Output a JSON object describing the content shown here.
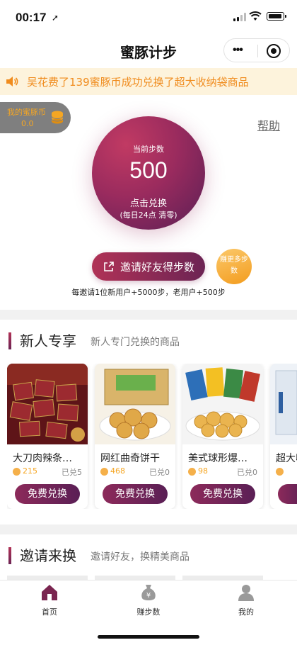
{
  "status_bar": {
    "time": "00:17",
    "location_icon": "location-arrow-icon"
  },
  "nav": {
    "title": "蜜豚计步",
    "more_icon": "more-dots-icon",
    "close_icon": "target-close-icon"
  },
  "notice": {
    "icon": "speaker-icon",
    "text": "吴花费了139蜜豚币成功兑换了超大收纳袋商品"
  },
  "coins": {
    "label": "我的蜜豚币",
    "value": "0.0",
    "icon": "coin-stack-icon"
  },
  "help_label": "帮助",
  "steps": {
    "label": "当前步数",
    "value": "500",
    "action": "点击兑换",
    "note": "(每日24点 清零)"
  },
  "invite_button": {
    "label": "邀请好友得步数",
    "icon": "share-icon"
  },
  "earn_button": {
    "label": "赚更多步数"
  },
  "invite_tip": "每邀请1位新用户+5000步，老用户+500步",
  "newbie_section": {
    "title": "新人专享",
    "subtitle": "新人专门兑换的商品",
    "products": [
      {
        "name": "大刀肉辣条…",
        "price": "215",
        "sold": "已兑5",
        "button": "免费兑换",
        "image": "spicy-strip-image"
      },
      {
        "name": "网红曲奇饼干",
        "price": "468",
        "sold": "已兑0",
        "button": "免费兑换",
        "image": "cookie-image"
      },
      {
        "name": "美式球形爆…",
        "price": "98",
        "sold": "已兑0",
        "button": "免费兑换",
        "image": "popcorn-image"
      },
      {
        "name": "超大收纳袋",
        "price": "",
        "sold": "",
        "button": "",
        "image": "storage-bag-image"
      }
    ]
  },
  "invite_section": {
    "title": "邀请来换",
    "subtitle": "邀请好友，换精美商品"
  },
  "tabs": [
    {
      "label": "首页",
      "icon": "home-icon",
      "active": true
    },
    {
      "label": "赚步数",
      "icon": "money-bag-icon",
      "active": false
    },
    {
      "label": "我的",
      "icon": "user-icon",
      "active": false
    }
  ],
  "colors": {
    "brand": "#8c2a5a",
    "accent": "#f5a623",
    "notice_bg": "#fdf3dc"
  }
}
